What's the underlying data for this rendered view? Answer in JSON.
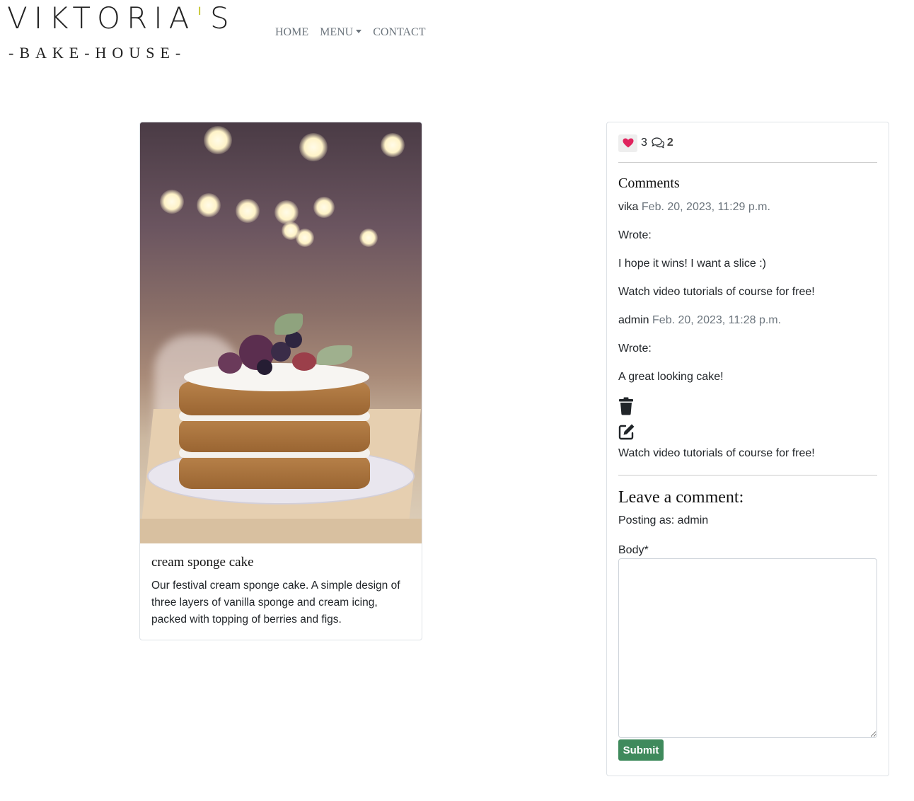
{
  "brand": {
    "title": "VIKTORIA",
    "apostrophe": "'",
    "title_end": "S",
    "subtitle": "-BAKE-HOUSE-",
    "accent_color": "#c9c838"
  },
  "nav": {
    "home": "HOME",
    "menu": "MENU",
    "contact": "CONTACT"
  },
  "post": {
    "title": "cream sponge cake",
    "description": "Our festival cream sponge cake. A simple design of three layers of vanilla sponge and cream icing, packed with topping of berries and figs."
  },
  "stats": {
    "likes": "3",
    "comments": "2",
    "like_color": "#e0245e"
  },
  "comments": {
    "heading": "Comments",
    "items": [
      {
        "author": "vika",
        "date": "Feb. 20, 2023, 11:29 p.m.",
        "wrote": "Wrote:",
        "body": "I hope it wins! I want a slice :)",
        "footer": "Watch video tutorials of course for free!"
      },
      {
        "author": "admin",
        "date": "Feb. 20, 2023, 11:28 p.m.",
        "wrote": "Wrote:",
        "body": "A great looking cake!",
        "footer": "Watch video tutorials of course for free!"
      }
    ]
  },
  "form": {
    "heading": "Leave a comment:",
    "posting_as": "Posting as: admin",
    "body_label": "Body*",
    "body_value": "",
    "submit_label": "Submit",
    "submit_color": "#3f8a5c"
  }
}
